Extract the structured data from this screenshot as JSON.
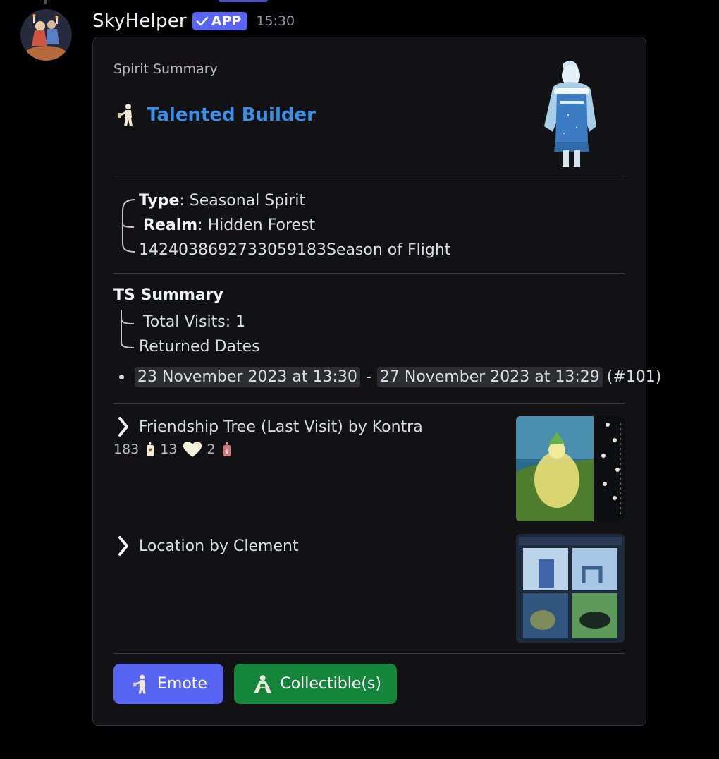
{
  "message": {
    "username": "SkyHelper",
    "badge": "APP",
    "timestamp": "15:30"
  },
  "embed": {
    "author": "Spirit Summary",
    "title": "Talented Builder",
    "title_icon": "builder-emote-icon",
    "accent_color": "#3c8fe8",
    "fields": {
      "type_label": "Type",
      "type_value": ": Seasonal Spirit",
      "realm_label": "Realm",
      "realm_value": ": Hidden Forest",
      "season_id": "1424038692733059183",
      "season_name": " Season of Flight"
    },
    "ts_summary": {
      "title": "TS Summary",
      "total_visits": "Total Visits: 1",
      "returned_dates": "Returned Dates",
      "date_from": "23 November 2023 at 13:30",
      "date_sep": "-",
      "date_to": "27 November 2023 at 13:29",
      "visit_no": "(#101)"
    },
    "friendship_tree": {
      "label": "Friendship Tree (Last Visit) by Kontra",
      "candles": "183",
      "hearts": "13",
      "ascended": "2"
    },
    "location": {
      "label": "Location by Clement"
    },
    "buttons": {
      "emote": "Emote",
      "collectibles": "Collectible(s)"
    }
  },
  "colors": {
    "button_primary": "#5865f2",
    "button_success": "#13863b",
    "embed_bg": "#121214"
  }
}
